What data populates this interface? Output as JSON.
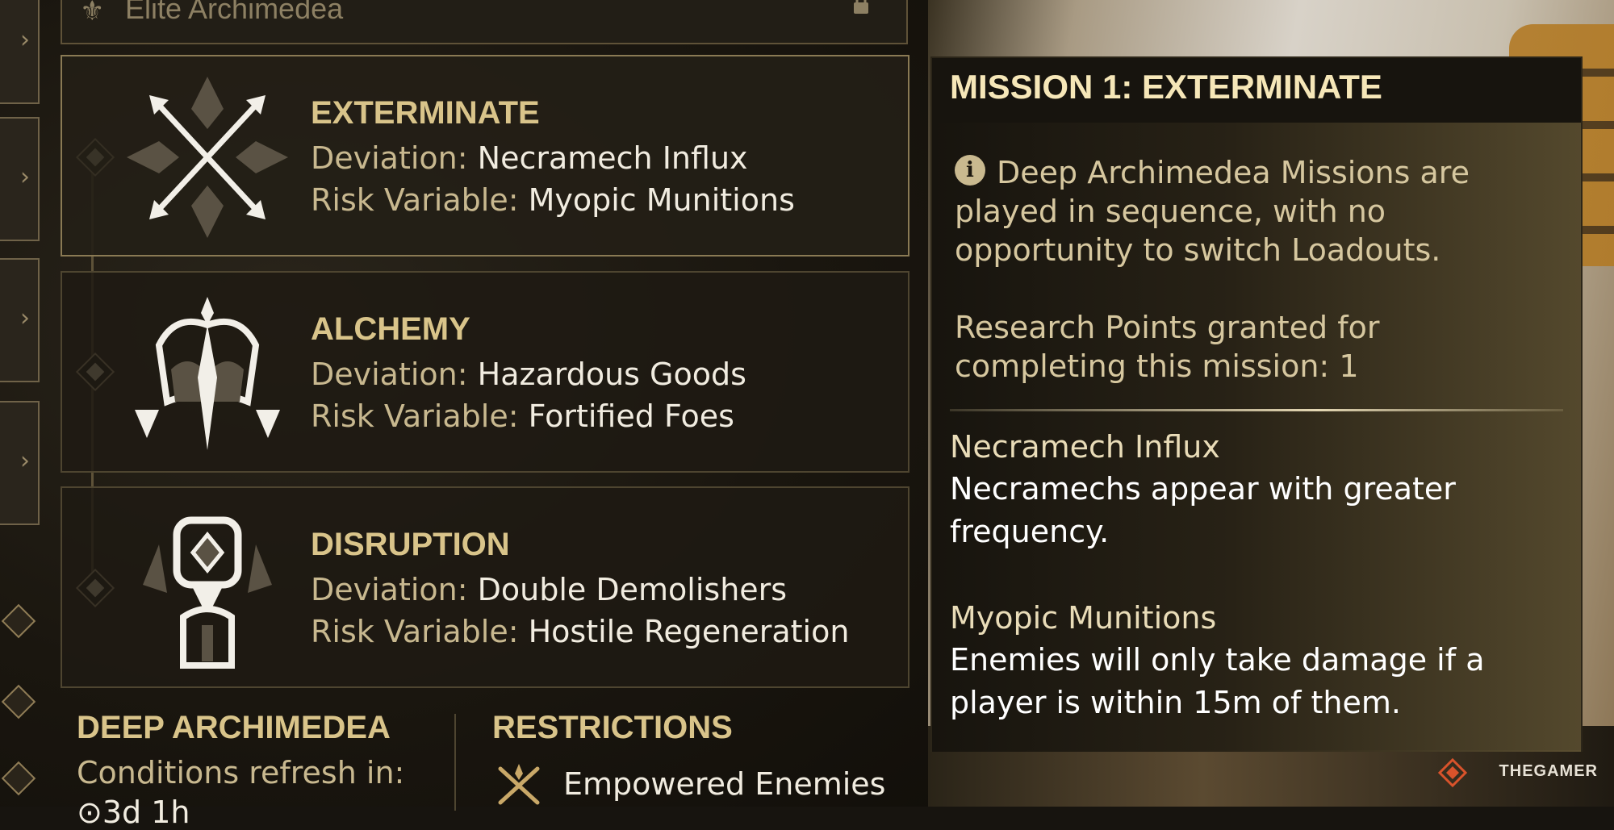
{
  "header": {
    "title": "Elite Archimedea"
  },
  "missions": [
    {
      "title": "EXTERMINATE",
      "deviation_label": "Deviation: ",
      "deviation": "Necramech Influx",
      "risk_label": "Risk Variable: ",
      "risk": "Myopic Munitions",
      "selected": true
    },
    {
      "title": "ALCHEMY",
      "deviation_label": "Deviation: ",
      "deviation": "Hazardous Goods",
      "risk_label": "Risk Variable: ",
      "risk": "Fortified Foes",
      "selected": false
    },
    {
      "title": "DISRUPTION",
      "deviation_label": "Deviation: ",
      "deviation": "Double Demolishers",
      "risk_label": "Risk Variable: ",
      "risk": "Hostile Regeneration",
      "selected": false
    }
  ],
  "deep": {
    "title": "DEEP ARCHIMEDEA",
    "refresh_label": "Conditions refresh in:",
    "timer": "⊙3d 1h"
  },
  "restrictions": {
    "title": "RESTRICTIONS",
    "item": "Empowered Enemies"
  },
  "panel": {
    "title": "MISSION 1: EXTERMINATE",
    "note": "Deep Archimedea Missions are played in sequence, with no opportunity to switch Loadouts.",
    "points": "Research Points granted for completing this mission: 1",
    "deviation_name": "Necramech Influx",
    "deviation_desc": "Necramechs appear with greater frequency.",
    "risk_name": "Myopic Munitions",
    "risk_desc": "Enemies will only take damage if a player is within 15m of them."
  },
  "watermark": "THEGAMER",
  "colors": {
    "accent_gold": "#d9c48a",
    "panel_title": "#f6e7b8",
    "text_white": "#f1ece0"
  }
}
